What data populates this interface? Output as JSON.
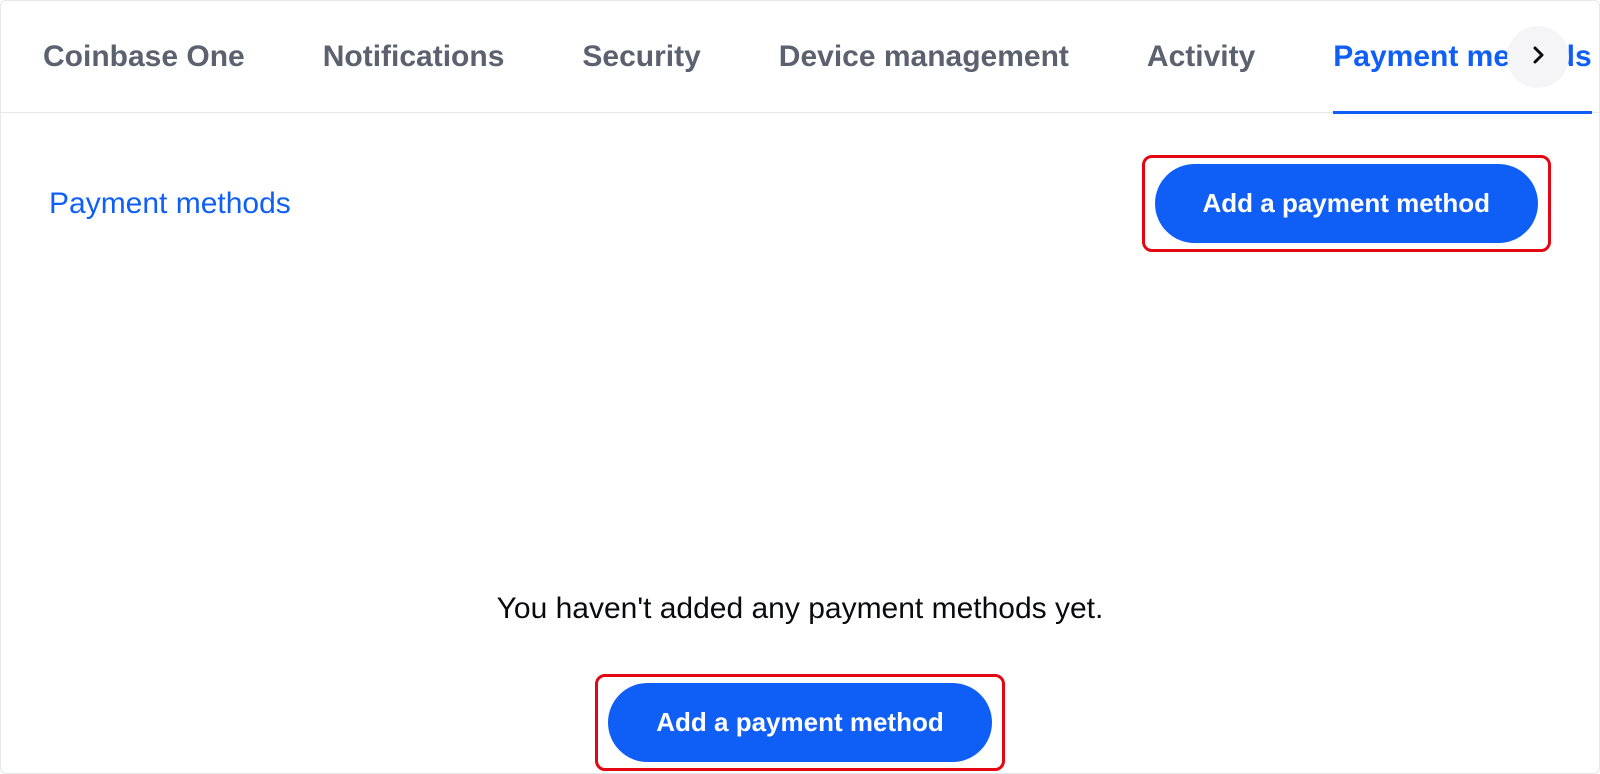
{
  "tabs": [
    {
      "label": "Coinbase One",
      "active": false
    },
    {
      "label": "Notifications",
      "active": false
    },
    {
      "label": "Security",
      "active": false
    },
    {
      "label": "Device management",
      "active": false
    },
    {
      "label": "Activity",
      "active": false
    },
    {
      "label": "Payment methods",
      "active": true
    }
  ],
  "section": {
    "title": "Payment methods",
    "add_button_label": "Add a payment method"
  },
  "empty_state": {
    "message": "You haven't added any payment methods yet.",
    "add_button_label": "Add a payment method"
  }
}
